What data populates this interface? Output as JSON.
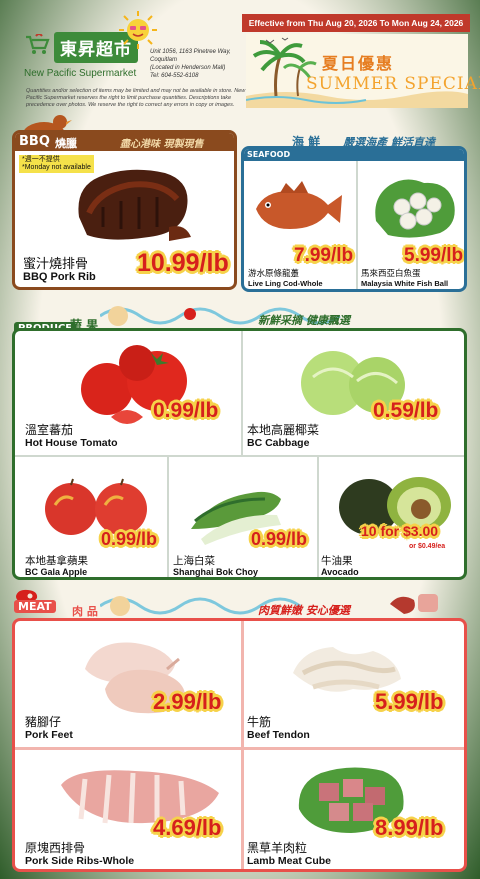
{
  "header": {
    "logo_cn": "東昇超市",
    "logo_en": "New Pacific Supermarket",
    "address": [
      "Unit 1056, 1163 Pinetree Way,",
      "Coquitlam",
      "(Located in Henderson Mall)",
      "Tel: 604-552-6108"
    ],
    "disclaimer": "Quantities and/or selection of items may be limited and may not be available in store. New Pacific Supermarket reserves the right to limit purchase quantities. Descriptions take precedence over photos. We reserve the right to correct any errors in copy or images.",
    "date_range": "Effective from Thu Aug 20, 2026 To Mon Aug 24, 2026",
    "summer_cn": "夏日優惠",
    "summer_en": "SUMMER SPECIAL"
  },
  "bbq": {
    "label": "BBQ",
    "label_cn": "燒臘",
    "slogan": "盡心港味 現製現售",
    "items": [
      {
        "cn": "蜜汁燒排骨",
        "en": "BBQ Pork Rib",
        "price": "10.99/lb",
        "note_cn": "*週一不提供",
        "note_en": "*Monday not available"
      }
    ]
  },
  "seafood": {
    "label": "SEAFOOD",
    "label_cn": "海 鮮",
    "slogan": "嚴選海產 鮮活直達",
    "items": [
      {
        "cn": "游水原條龍躉",
        "en": "Live Ling Cod-Whole",
        "price": "7.99/lb"
      },
      {
        "cn": "馬來西亞白魚蛋",
        "en": "Malaysia White Fish Ball",
        "price": "5.99/lb"
      }
    ]
  },
  "produce": {
    "label": "PRODUCE",
    "label_cn": "蔬 果",
    "slogan": "新鮮采摘 健康飄選",
    "items": [
      {
        "cn": "溫室蕃茄",
        "en": "Hot House Tomato",
        "price": "0.99/lb"
      },
      {
        "cn": "本地高麗椰菜",
        "en": "BC Cabbage",
        "price": "0.59/lb"
      },
      {
        "cn": "本地基拿蘋果",
        "en": "BC Gala Apple",
        "price": "0.99/lb"
      },
      {
        "cn": "上海白菜",
        "en": "Shanghai Bok Choy",
        "price": "0.99/lb"
      },
      {
        "cn": "牛油果",
        "en": "Avocado",
        "price": "10 for $3.00",
        "subnote": "or $0.49/ea"
      }
    ]
  },
  "meat": {
    "label": "MEAT",
    "label_cn": "肉 品",
    "slogan": "肉質鮮嫩 安心優選",
    "items": [
      {
        "cn": "豬腳仔",
        "en": "Pork Feet",
        "price": "2.99/lb"
      },
      {
        "cn": "牛筋",
        "en": "Beef Tendon",
        "price": "5.99/lb"
      },
      {
        "cn": "原塊西排骨",
        "en": "Pork Side Ribs-Whole",
        "price": "4.69/lb"
      },
      {
        "cn": "黑草羊肉粒",
        "en": "Lamb Meat Cube",
        "price": "8.99/lb"
      }
    ]
  },
  "colors": {
    "green": "#2f6e2c",
    "brown": "#8a4a1e",
    "blue": "#2a6f97",
    "red": "#e8504a",
    "price_red": "#d6201c",
    "price_outline": "#f6d24a"
  }
}
